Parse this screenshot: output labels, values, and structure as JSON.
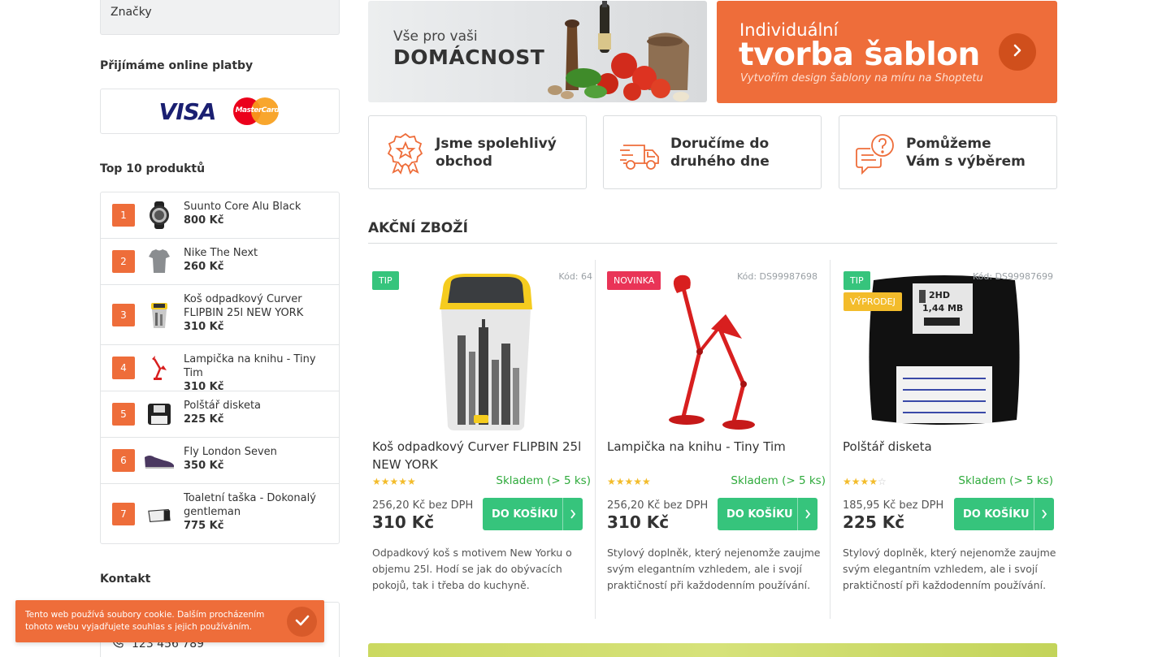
{
  "sidebar": {
    "brands_label": "Značky",
    "payments_heading": "Přijímáme online platby",
    "visa_label": "VISA",
    "mastercard_label": "MasterCard",
    "top_heading": "Top 10 produktů",
    "top_items": [
      {
        "num": "1",
        "name": "Suunto Core Alu Black",
        "price": "800 Kč"
      },
      {
        "num": "2",
        "name": "Nike The Next",
        "price": "260 Kč"
      },
      {
        "num": "3",
        "name": "Koš odpadkový Curver FLIPBIN 25l NEW YORK",
        "price": "310 Kč"
      },
      {
        "num": "4",
        "name": "Lampička na knihu - Tiny Tim",
        "price": "310 Kč"
      },
      {
        "num": "5",
        "name": "Polštář disketa",
        "price": "225 Kč"
      },
      {
        "num": "6",
        "name": "Fly London Seven",
        "price": "350 Kč"
      },
      {
        "num": "7",
        "name": "Toaletní taška - Dokonalý gentleman",
        "price": "775 Kč"
      }
    ],
    "contact_heading": "Kontakt",
    "contact_phone": "123 456 789"
  },
  "cookie": {
    "text": "Tento web používá soubory cookie. Dalším procházením tohoto webu vyjadřujete souhlas s jejich používáním."
  },
  "banners": {
    "home_sub": "Vše pro vaši",
    "home_title": "DOMÁCNOST",
    "template_sub": "Individuální",
    "template_title": "tvorba šablon",
    "template_tagline": "Vytvořím design šablony na míru na Shoptetu"
  },
  "benefits": [
    {
      "text": "Jsme spolehlivý obchod",
      "icon": "badge-star-icon"
    },
    {
      "text": "Doručíme do druhého dne",
      "icon": "delivery-truck-icon"
    },
    {
      "text": "Pomůžeme Vám s výběrem",
      "icon": "chat-help-icon"
    }
  ],
  "section_title": "AKČNÍ ZBOŽÍ",
  "products": [
    {
      "flags": [
        "TIP"
      ],
      "code": "Kód: 64",
      "name": "Koš odpadkový Curver FLIPBIN 25l NEW YORK",
      "rating": 5,
      "stars": "★★★★★",
      "stock": "Skladem (> 5 ks)",
      "price_novat": "256,20 Kč bez DPH",
      "price": "310 Kč",
      "button": "DO KOŠÍKU",
      "description": "Odpadkový koš s motivem New Yorku o objemu 25l. Hodí se jak do obývacích pokojů, tak i třeba do kuchyně."
    },
    {
      "flags": [
        "NOVINKA"
      ],
      "code": "Kód: DS99987698",
      "name": "Lampička na knihu - Tiny Tim",
      "rating": 5,
      "stars": "★★★★★",
      "stock": "Skladem (> 5 ks)",
      "price_novat": "256,20 Kč bez DPH",
      "price": "310 Kč",
      "button": "DO KOŠÍKU",
      "description": "Stylový doplněk, který nejenomže zaujme svým elegantním vzhledem, ale i svojí praktičností při každodenním používání."
    },
    {
      "flags": [
        "TIP",
        "VÝPRODEJ"
      ],
      "code": "Kód: DS99987699",
      "name": "Polštář disketa",
      "rating": 4,
      "stars": "★★★★",
      "stars_empty": "☆",
      "stock": "Skladem (> 5 ks)",
      "price_novat": "185,95 Kč bez DPH",
      "price": "225 Kč",
      "button": "DO KOŠÍKU",
      "description": "Stylový doplněk, který nejenomže zaujme svým elegantním vzhledem, ale i svojí praktičností při každodenním používání."
    }
  ],
  "colors": {
    "accent": "#ee6d3a",
    "button": "#36c47c",
    "stock": "#2eaa3b",
    "flag_new": "#e93457",
    "flag_sale": "#f3bc2b"
  }
}
